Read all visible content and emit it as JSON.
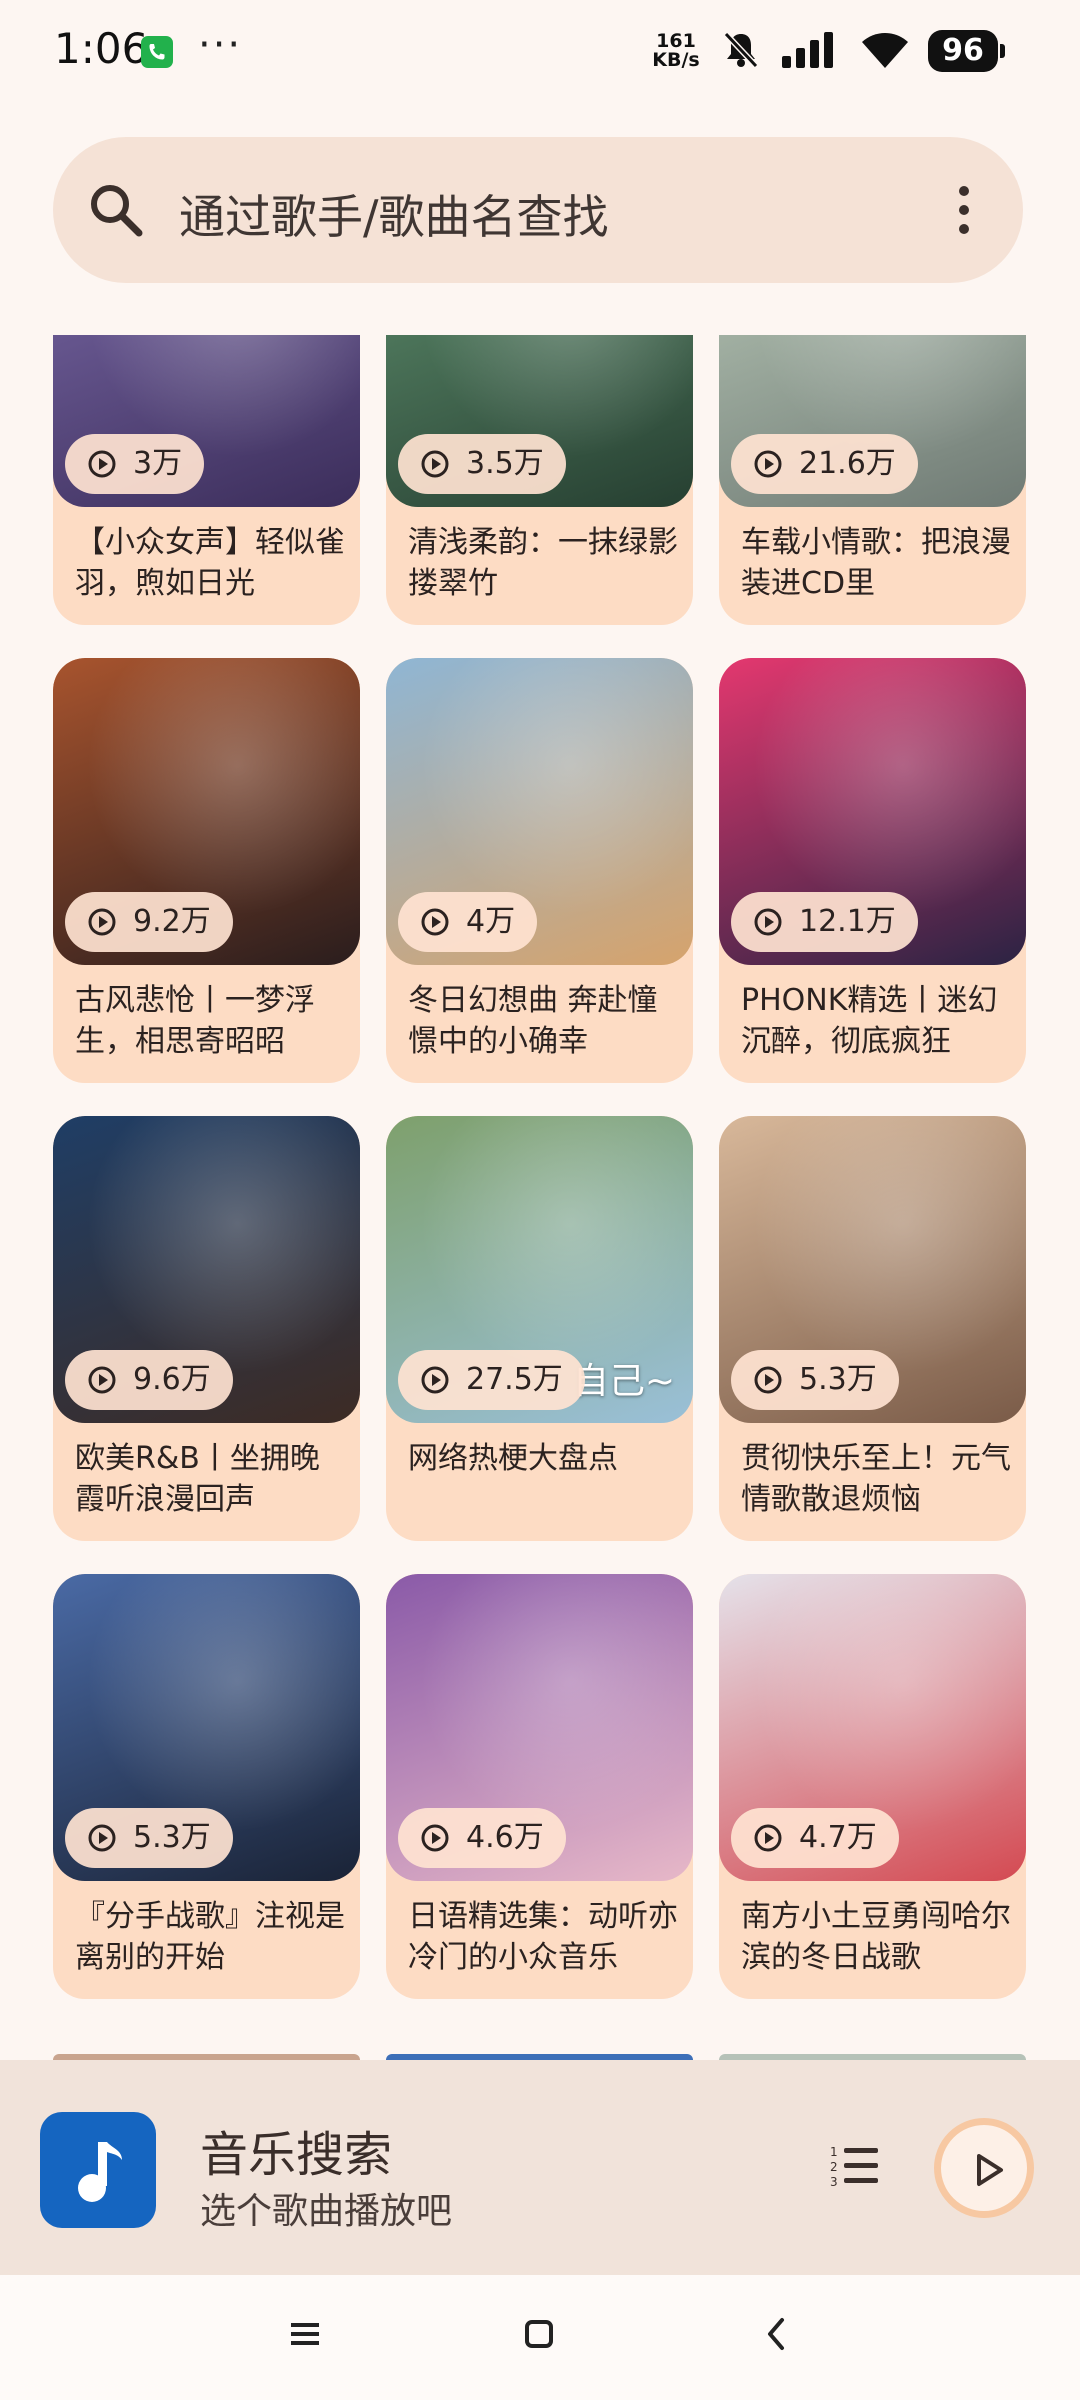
{
  "status": {
    "time": "1:06",
    "more": "···",
    "net_speed_value": "161",
    "net_speed_unit": "KB/s",
    "battery": "96"
  },
  "search": {
    "placeholder": "通过歌手/歌曲名查找"
  },
  "playlists": [
    {
      "plays": "3万",
      "title": "【小众女声】轻似雀羽，煦如日光",
      "colors": [
        "#7b6aa8",
        "#3b2d5a"
      ]
    },
    {
      "plays": "3.5万",
      "title": "清浅柔韵：一抹绿影搂翠竹",
      "colors": [
        "#5f8f6e",
        "#263f31"
      ]
    },
    {
      "plays": "21.6万",
      "title": "车载小情歌：把浪漫装进CD里",
      "colors": [
        "#b9c9b8",
        "#6f7a74"
      ]
    },
    {
      "plays": "9.2万",
      "title": "古风悲怆丨一梦浮生，相思寄昭昭",
      "colors": [
        "#a8542e",
        "#2a1d1d"
      ]
    },
    {
      "plays": "4万",
      "title": "冬日幻想曲 奔赴憧憬中的小确幸",
      "colors": [
        "#8fb6d4",
        "#d6a36c"
      ]
    },
    {
      "plays": "12.1万",
      "title": "PHONK精选丨迷幻沉醉，彻底疯狂",
      "colors": [
        "#e4386f",
        "#2b2343"
      ]
    },
    {
      "plays": "9.6万",
      "title": "欧美R&B丨坐拥晚霞听浪漫回声",
      "colors": [
        "#1f3e66",
        "#3d2b24"
      ]
    },
    {
      "plays": "27.5万",
      "title": "网络热梗大盘点",
      "overlay": "自己~",
      "colors": [
        "#7ea06c",
        "#9ac0d8"
      ]
    },
    {
      "plays": "5.3万",
      "title": "贯彻快乐至上！元气情歌散退烦恼",
      "colors": [
        "#d8b89a",
        "#7a5b48"
      ]
    },
    {
      "plays": "5.3万",
      "title": "『分手战歌』注视是离别的开始",
      "colors": [
        "#4a6aa5",
        "#1a2336"
      ]
    },
    {
      "plays": "4.6万",
      "title": "日语精选集：动听亦冷门的小众音乐",
      "colors": [
        "#8a5aa8",
        "#e7b8c8"
      ]
    },
    {
      "plays": "4.7万",
      "title": "南方小土豆勇闯哈尔滨的冬日战歌",
      "colors": [
        "#e5e2ea",
        "#d44a52"
      ]
    }
  ],
  "peek_colors": [
    "#c9a48e",
    "#3d6fb8",
    "#b6c2b8"
  ],
  "player": {
    "title": "音乐搜索",
    "subtitle": "选个歌曲播放吧"
  },
  "colors": {
    "background": "#fdf6f2",
    "card": "#fddcc4",
    "search_bg": "#f5e2d6",
    "app_icon": "#1565c0"
  }
}
